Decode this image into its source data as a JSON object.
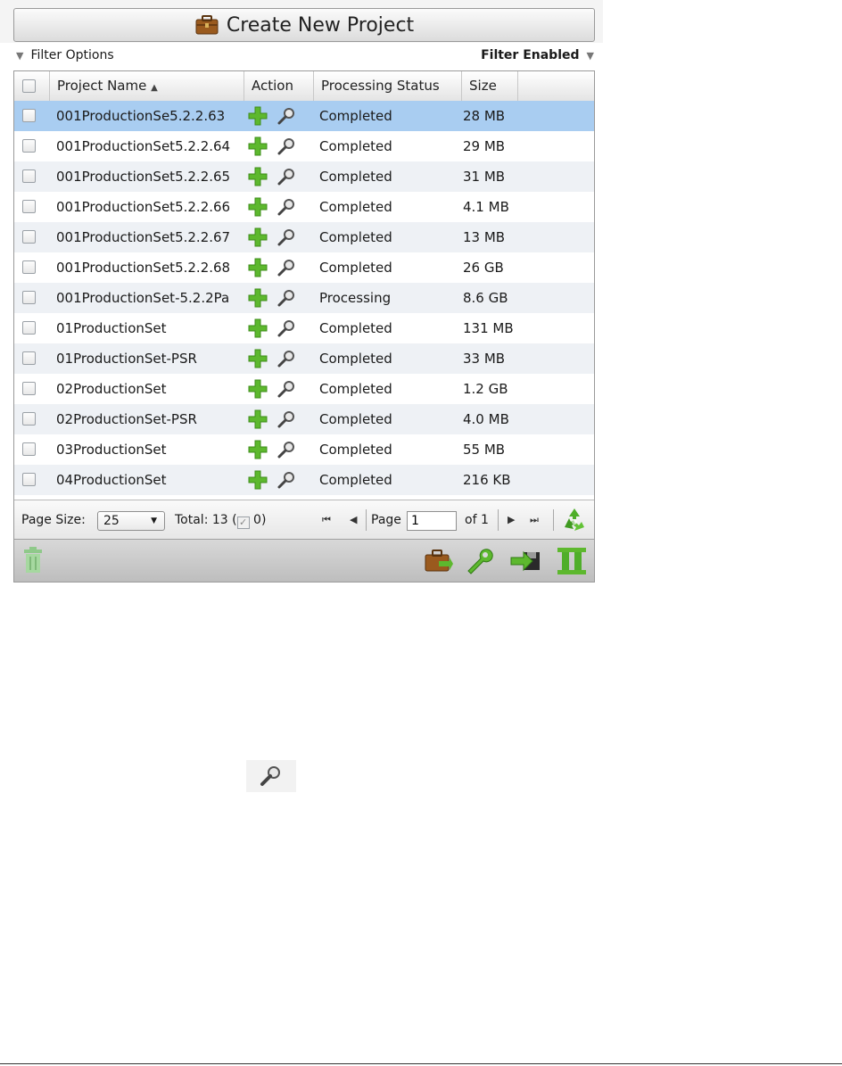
{
  "create_button": {
    "label": "Create New Project",
    "icon": "briefcase-icon"
  },
  "filter": {
    "options_label": "Filter Options",
    "status_label": "Filter Enabled"
  },
  "columns": {
    "name": "Project Name",
    "action": "Action",
    "status": "Processing Status",
    "size": "Size",
    "sort_indicator": "▲"
  },
  "rows": [
    {
      "name": "001ProductionSe5.2.2.63",
      "status": "Completed",
      "size": "28 MB",
      "selected": true
    },
    {
      "name": "001ProductionSet5.2.2.64",
      "status": "Completed",
      "size": "29 MB"
    },
    {
      "name": "001ProductionSet5.2.2.65",
      "status": "Completed",
      "size": "31 MB"
    },
    {
      "name": "001ProductionSet5.2.2.66",
      "status": "Completed",
      "size": "4.1 MB"
    },
    {
      "name": "001ProductionSet5.2.2.67",
      "status": "Completed",
      "size": "13 MB"
    },
    {
      "name": "001ProductionSet5.2.2.68",
      "status": "Completed",
      "size": "26 GB"
    },
    {
      "name": "001ProductionSet-5.2.2Pa",
      "status": "Processing",
      "size": "8.6 GB"
    },
    {
      "name": "01ProductionSet",
      "status": "Completed",
      "size": "131 MB"
    },
    {
      "name": "01ProductionSet-PSR",
      "status": "Completed",
      "size": "33 MB"
    },
    {
      "name": "02ProductionSet",
      "status": "Completed",
      "size": "1.2 GB"
    },
    {
      "name": "02ProductionSet-PSR",
      "status": "Completed",
      "size": "4.0 MB"
    },
    {
      "name": "03ProductionSet",
      "status": "Completed",
      "size": "55 MB"
    },
    {
      "name": "04ProductionSet",
      "status": "Completed",
      "size": "216 KB"
    }
  ],
  "pager": {
    "page_size_label": "Page Size:",
    "page_size_value": "25",
    "total_label": "Total: 13 (",
    "checked_count": "0)",
    "page_label": "Page",
    "page_value": "1",
    "of_label": "of 1"
  },
  "colors": {
    "selected_row": "#a9cdf1",
    "alt_row": "#eef1f5",
    "icon_green": "#5db82e"
  },
  "icons": [
    "add-icon",
    "magnifier-icon",
    "recycle-icon",
    "trash-icon",
    "briefcase-icon",
    "wrench-icon",
    "export-icon",
    "pause-icon"
  ]
}
